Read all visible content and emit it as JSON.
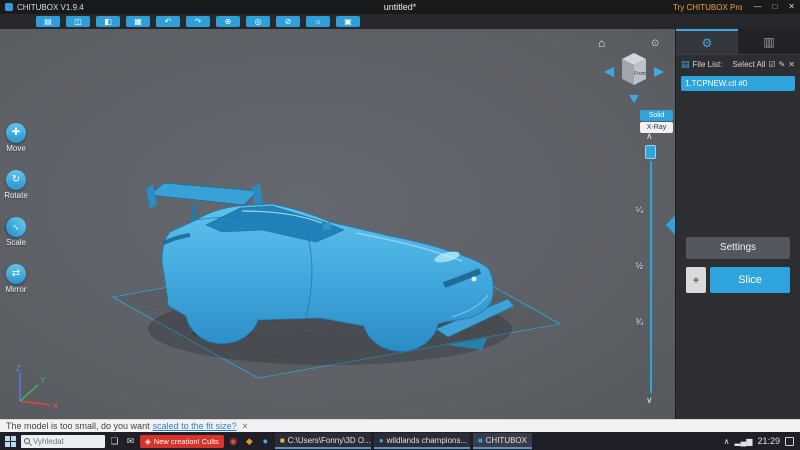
{
  "titlebar": {
    "app_title": "CHITUBOX V1.9.4",
    "doc_title": "untitled*",
    "pro_link": "Try CHITUBOX Pro",
    "minimize": "—",
    "maximize": "□",
    "close": "✕"
  },
  "toolbar": {
    "buttons": [
      {
        "name": "open-file",
        "glyph": "▤"
      },
      {
        "name": "save",
        "glyph": "◫"
      },
      {
        "name": "copy",
        "glyph": "◧"
      },
      {
        "name": "auto-layout",
        "glyph": "▦"
      },
      {
        "name": "undo",
        "glyph": "↶"
      },
      {
        "name": "redo",
        "glyph": "↷"
      },
      {
        "name": "center-model",
        "glyph": "⊕"
      },
      {
        "name": "hollow",
        "glyph": "◎"
      },
      {
        "name": "dig-hole",
        "glyph": "⊘"
      },
      {
        "name": "light",
        "glyph": "☼"
      },
      {
        "name": "info",
        "glyph": "▣"
      }
    ]
  },
  "tools": {
    "items": [
      {
        "name": "move",
        "label": "Move",
        "glyph": "✚"
      },
      {
        "name": "rotate",
        "label": "Rotate",
        "glyph": "↻"
      },
      {
        "name": "scale",
        "label": "Scale",
        "glyph": "↔"
      },
      {
        "name": "mirror",
        "label": "Mirror",
        "glyph": "⇄"
      }
    ]
  },
  "viewport": {
    "home_glyph": "⌂",
    "persp_glyph": "⊙",
    "cube_face": "Front",
    "solid_label": "Solid",
    "xray_label": "X-Ray",
    "caret_up": "∧",
    "caret_down": "∨",
    "slider": {
      "fractions": [
        "¼",
        "½",
        "¾"
      ]
    },
    "axes": {
      "z": "Z",
      "y": "Y",
      "x": "X"
    },
    "colors": {
      "accent": "#2ea3dc",
      "model_blue": "#3fa9e0",
      "background": "#5f6266"
    }
  },
  "right_panel": {
    "tabs": [
      {
        "name": "print-settings",
        "glyph": "⚙"
      },
      {
        "name": "support-settings",
        "glyph": "▥"
      }
    ],
    "file_list_label": "File List:",
    "select_all_label": "Select All",
    "header_icons": [
      {
        "name": "select-all-checkbox",
        "glyph": "☑"
      },
      {
        "name": "edit",
        "glyph": "✎"
      },
      {
        "name": "delete",
        "glyph": "✕"
      }
    ],
    "file_item": "1.TCPNEW.ctl #0",
    "settings_button": "Settings",
    "slice_plus": "+",
    "slice_button": "Slice"
  },
  "status": {
    "prefix": "The model is too small, do you want",
    "link": "scaled to the fit size?",
    "close": "✕"
  },
  "taskbar": {
    "search_placeholder": "Vyhledat",
    "task_view_glyph": "❏",
    "app_icons": [
      {
        "name": "mail",
        "glyph": "✉"
      },
      {
        "name": "opera",
        "glyph": "◉"
      },
      {
        "name": "palette",
        "glyph": "◆"
      },
      {
        "name": "steam",
        "glyph": "●"
      }
    ],
    "cults_icon": "◈",
    "cults_label": "New creation! Cults",
    "windows": [
      {
        "name": "explorer-window",
        "glyph": "■",
        "label": "C:\\Users\\Fonny\\3D O..."
      },
      {
        "name": "browser-window",
        "glyph": "●",
        "label": "wildlands champions..."
      },
      {
        "name": "chitubox-window",
        "glyph": "■",
        "label": "CHITUBOX"
      }
    ],
    "tray_caret": "∧",
    "network_glyph": "▂▄▆",
    "time": "21:29"
  }
}
